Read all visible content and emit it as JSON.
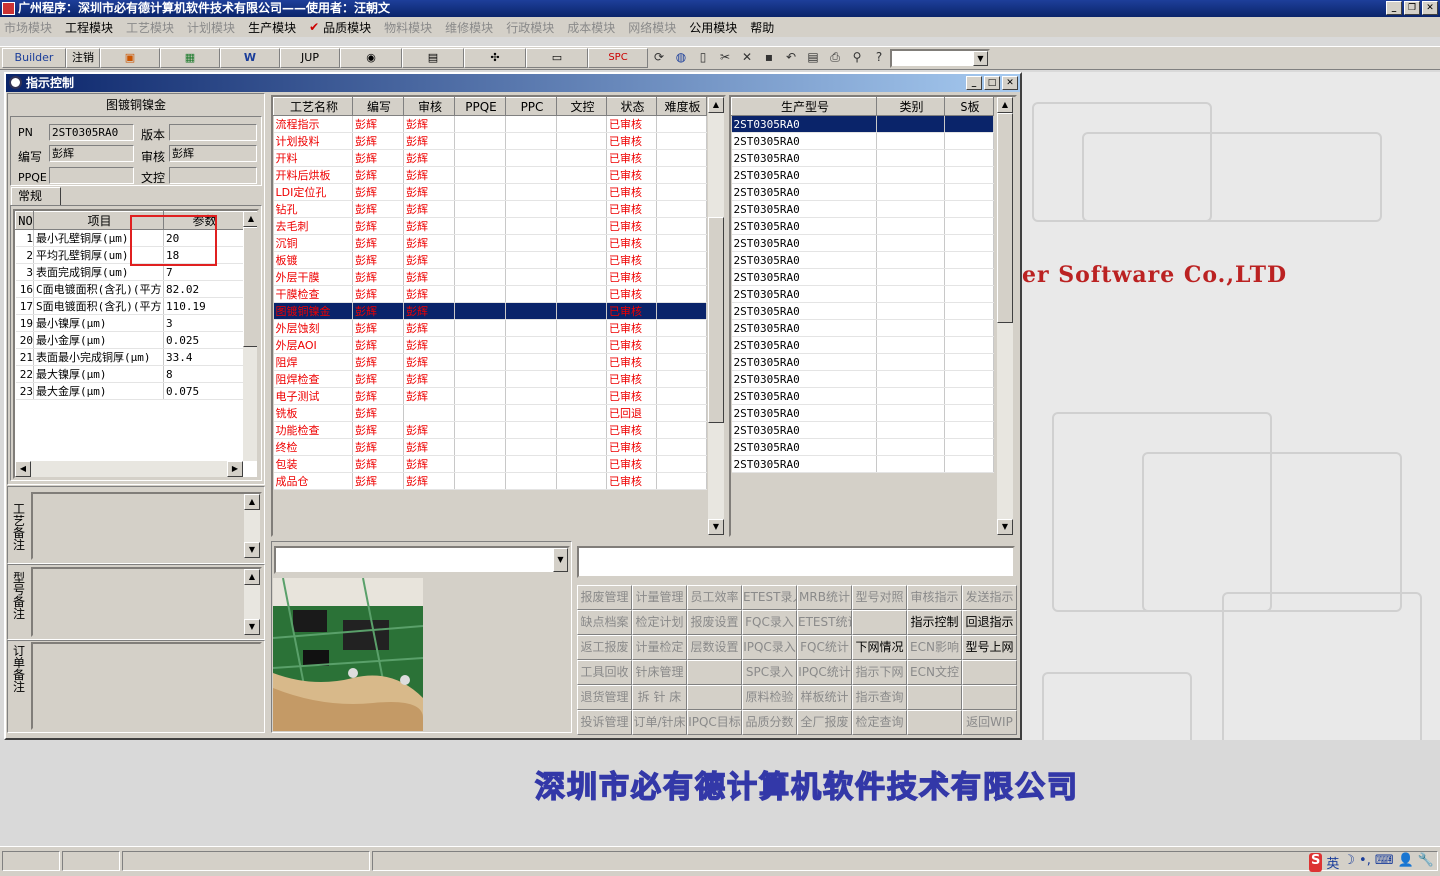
{
  "window": {
    "title": "广州程序：深圳市必有德计算机软件技术有限公司——使用者：汪朝文"
  },
  "menu": [
    {
      "label": "市场模块",
      "enabled": false
    },
    {
      "label": "工程模块",
      "enabled": true
    },
    {
      "label": "工艺模块",
      "enabled": false
    },
    {
      "label": "计划模块",
      "enabled": false
    },
    {
      "label": "生产模块",
      "enabled": true
    },
    {
      "label": "品质模块",
      "enabled": true,
      "checked": true
    },
    {
      "label": "物料模块",
      "enabled": false
    },
    {
      "label": "维修模块",
      "enabled": false
    },
    {
      "label": "行政模块",
      "enabled": false
    },
    {
      "label": "成本模块",
      "enabled": false
    },
    {
      "label": "网络模块",
      "enabled": false
    },
    {
      "label": "公用模块",
      "enabled": true
    },
    {
      "label": "帮助",
      "enabled": true
    }
  ],
  "toolbar": {
    "builder": "Builder",
    "logout": "注销",
    "jup": "JUP",
    "spc": "SPC"
  },
  "child": {
    "title": "指示控制"
  },
  "left": {
    "header": "图镀铜镍金",
    "pn_label": "PN",
    "pn_value": "2ST0305RA0",
    "version_label": "版本",
    "version_value": "",
    "author_label": "编写",
    "author_value": "彭辉",
    "review_label": "审核",
    "review_value": "彭辉",
    "ppqe_label": "PPQE",
    "ppqe_value": "",
    "wenkong_label": "文控",
    "wenkong_value": "",
    "tab": "常规",
    "param_headers": [
      "NO",
      "项目",
      "参数"
    ],
    "params": [
      [
        "1",
        "最小孔壁铜厚(μm)",
        "20"
      ],
      [
        "2",
        "平均孔壁铜厚(um)",
        "18"
      ],
      [
        "3",
        "表面完成铜厚(um)",
        "7"
      ],
      [
        "16",
        "C面电镀面积(含孔)(平方",
        "82.02"
      ],
      [
        "17",
        "S面电镀面积(含孔)(平方",
        "110.19"
      ],
      [
        "19",
        "最小镍厚(μm)",
        "3"
      ],
      [
        "20",
        "最小金厚(μm)",
        "0.025"
      ],
      [
        "21",
        "表面最小完成铜厚(μm)",
        "33.4"
      ],
      [
        "22",
        "最大镍厚(μm)",
        "8"
      ],
      [
        "23",
        "最大金厚(μm)",
        "0.075"
      ]
    ],
    "note1": "工艺备注",
    "note2": "型号备注",
    "note3": "订单备注"
  },
  "process": {
    "headers": [
      "工艺名称",
      "编写",
      "审核",
      "PPQE",
      "PPC",
      "文控",
      "状态",
      "难度板"
    ],
    "rows": [
      [
        "流程指示",
        "彭辉",
        "彭辉",
        "已审核"
      ],
      [
        "计划投料",
        "彭辉",
        "彭辉",
        "已审核"
      ],
      [
        "开料",
        "彭辉",
        "彭辉",
        "已审核"
      ],
      [
        "开料后烘板",
        "彭辉",
        "彭辉",
        "已审核"
      ],
      [
        "LDI定位孔",
        "彭辉",
        "彭辉",
        "已审核"
      ],
      [
        "钻孔",
        "彭辉",
        "彭辉",
        "已审核"
      ],
      [
        "去毛刺",
        "彭辉",
        "彭辉",
        "已审核"
      ],
      [
        "沉铜",
        "彭辉",
        "彭辉",
        "已审核"
      ],
      [
        "板镀",
        "彭辉",
        "彭辉",
        "已审核"
      ],
      [
        "外层干膜",
        "彭辉",
        "彭辉",
        "已审核"
      ],
      [
        "干膜检查",
        "彭辉",
        "彭辉",
        "已审核"
      ],
      [
        "图镀铜镍金",
        "彭辉",
        "彭辉",
        "已审核"
      ],
      [
        "外层蚀刻",
        "彭辉",
        "彭辉",
        "已审核"
      ],
      [
        "外层AOI",
        "彭辉",
        "彭辉",
        "已审核"
      ],
      [
        "阻焊",
        "彭辉",
        "彭辉",
        "已审核"
      ],
      [
        "阻焊检查",
        "彭辉",
        "彭辉",
        "已审核"
      ],
      [
        "电子测试",
        "彭辉",
        "彭辉",
        "已审核"
      ],
      [
        "铣板",
        "彭辉",
        "",
        "已回退"
      ],
      [
        "功能检查",
        "彭辉",
        "彭辉",
        "已审核"
      ],
      [
        "终检",
        "彭辉",
        "彭辉",
        "已审核"
      ],
      [
        "包装",
        "彭辉",
        "彭辉",
        "已审核"
      ],
      [
        "成品仓",
        "彭辉",
        "彭辉",
        "已审核"
      ]
    ],
    "selected_index": 11
  },
  "models": {
    "headers": [
      "生产型号",
      "类别",
      "S板"
    ],
    "rows": [
      "2ST0305RA0",
      "2ST0305RA0",
      "2ST0305RA0",
      "2ST0305RA0",
      "2ST0305RA0",
      "2ST0305RA0",
      "2ST0305RA0",
      "2ST0305RA0",
      "2ST0305RA0",
      "2ST0305RA0",
      "2ST0305RA0",
      "2ST0305RA0",
      "2ST0305RA0",
      "2ST0305RA0",
      "2ST0305RA0",
      "2ST0305RA0",
      "2ST0305RA0",
      "2ST0305RA0",
      "2ST0305RA0",
      "2ST0305RA0",
      "2ST0305RA0"
    ]
  },
  "buttons": [
    [
      "报废管理",
      false
    ],
    [
      "计量管理",
      false
    ],
    [
      "员工效率",
      false
    ],
    [
      "ETEST录入",
      false
    ],
    [
      "MRB统计",
      false
    ],
    [
      "型号对照",
      false
    ],
    [
      "审核指示",
      false
    ],
    [
      "发送指示",
      false
    ],
    [
      "缺点档案",
      false
    ],
    [
      "检定计划",
      false
    ],
    [
      "报废设置",
      false
    ],
    [
      "FQC录入",
      false
    ],
    [
      "ETEST统计",
      false
    ],
    [
      "",
      false
    ],
    [
      "指示控制",
      true
    ],
    [
      "回退指示",
      true
    ],
    [
      "返工报废",
      false
    ],
    [
      "计量检定",
      false
    ],
    [
      "层数设置",
      false
    ],
    [
      "IPQC录入",
      false
    ],
    [
      "FQC统计",
      false
    ],
    [
      "下网情况",
      true
    ],
    [
      "ECN影响",
      false
    ],
    [
      "型号上网",
      true
    ],
    [
      "工具回收",
      false
    ],
    [
      "针床管理",
      false
    ],
    [
      "",
      false
    ],
    [
      "SPC录入",
      false
    ],
    [
      "IPQC统计",
      false
    ],
    [
      "指示下网",
      false
    ],
    [
      "ECN文控",
      false
    ],
    [
      "",
      false
    ],
    [
      "退货管理",
      false
    ],
    [
      "拆 针 床",
      false
    ],
    [
      "",
      false
    ],
    [
      "原料检验",
      false
    ],
    [
      "样板统计",
      false
    ],
    [
      "指示查询",
      false
    ],
    [
      "",
      false
    ],
    [
      "",
      false
    ],
    [
      "投诉管理",
      false
    ],
    [
      "订单/针床",
      false
    ],
    [
      "IPQC目标",
      false
    ],
    [
      "品质分数",
      false
    ],
    [
      "全厂报废",
      false
    ],
    [
      "检定查询",
      false
    ],
    [
      "",
      false
    ],
    [
      "返回WIP",
      false
    ]
  ],
  "desktop": {
    "company_en": "er Software Co.,LTD",
    "company_cn": "深圳市必有德计算机软件技术有限公司"
  },
  "tray": {
    "ime": "英"
  }
}
